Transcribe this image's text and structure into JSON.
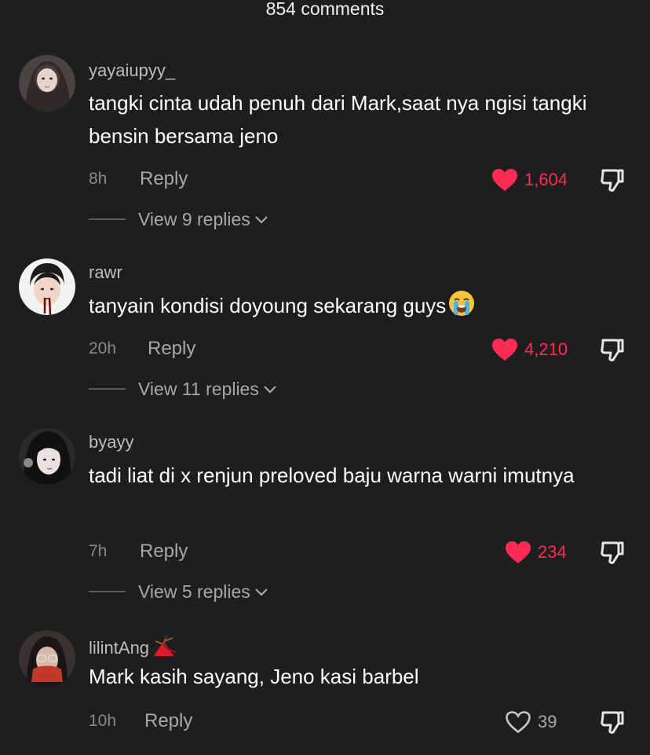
{
  "header": {
    "title": "854 comments"
  },
  "colors": {
    "liked": "#fe2c55",
    "muted": "#a8a8a8",
    "background": "#1e1e1e"
  },
  "comments": [
    {
      "username": "yayaiupyy_",
      "text": "tangki cinta udah penuh dari Mark,saat nya ngisi tangki bensin bersama jeno",
      "time": "8h",
      "reply_label": "Reply",
      "likes": "1,604",
      "liked": true,
      "view_replies": "View 9 replies"
    },
    {
      "username": "rawr",
      "text": "tanyain kondisi doyoung sekarang guys",
      "text_emoji": "loudly-crying-face-icon",
      "time": "20h",
      "reply_label": "Reply",
      "likes": "4,210",
      "liked": true,
      "view_replies": "View 11 replies"
    },
    {
      "username": "byayy",
      "text": "tadi liat di x renjun preloved baju warna warni imutnya",
      "time": "7h",
      "reply_label": "Reply",
      "likes": "234",
      "liked": true,
      "view_replies": "View 5 replies"
    },
    {
      "username": "lilintAng",
      "username_emoji": "dancer-icon",
      "text": "Mark kasih sayang, Jeno kasi barbel",
      "time": "10h",
      "reply_label": "Reply",
      "likes": "39",
      "liked": false
    }
  ]
}
